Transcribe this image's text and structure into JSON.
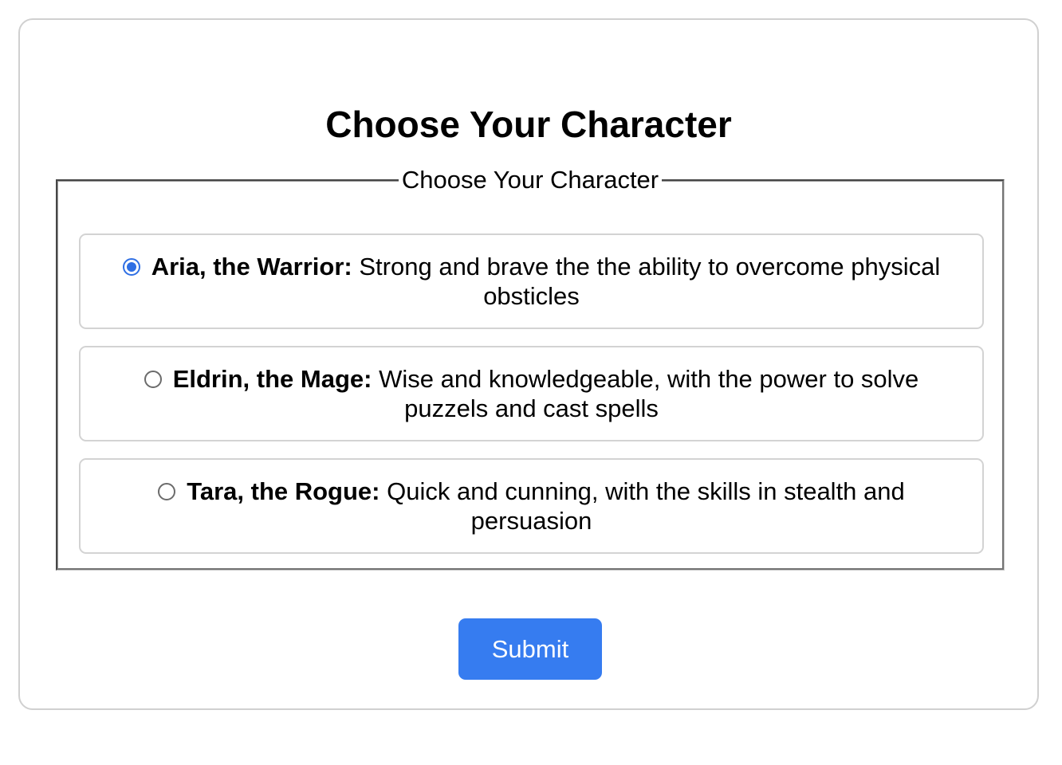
{
  "page": {
    "title": "Choose Your Character"
  },
  "character_form": {
    "legend": "Choose Your Character",
    "selected_index": 0,
    "options": [
      {
        "name": "Aria, the Warrior:",
        "description": "Strong and brave the the ability to overcome physical obsticles",
        "selected": true
      },
      {
        "name": "Eldrin, the Mage:",
        "description": "Wise and knowledgeable, with the power to solve puzzels and cast spells",
        "selected": false
      },
      {
        "name": "Tara, the Rogue:",
        "description": "Quick and cunning, with the skills in stealth and persuasion",
        "selected": false
      }
    ],
    "submit_label": "Submit"
  },
  "colors": {
    "accent": "#367cf0",
    "radio_checked": "#2f6fe4",
    "border": "#d3d3d3"
  }
}
